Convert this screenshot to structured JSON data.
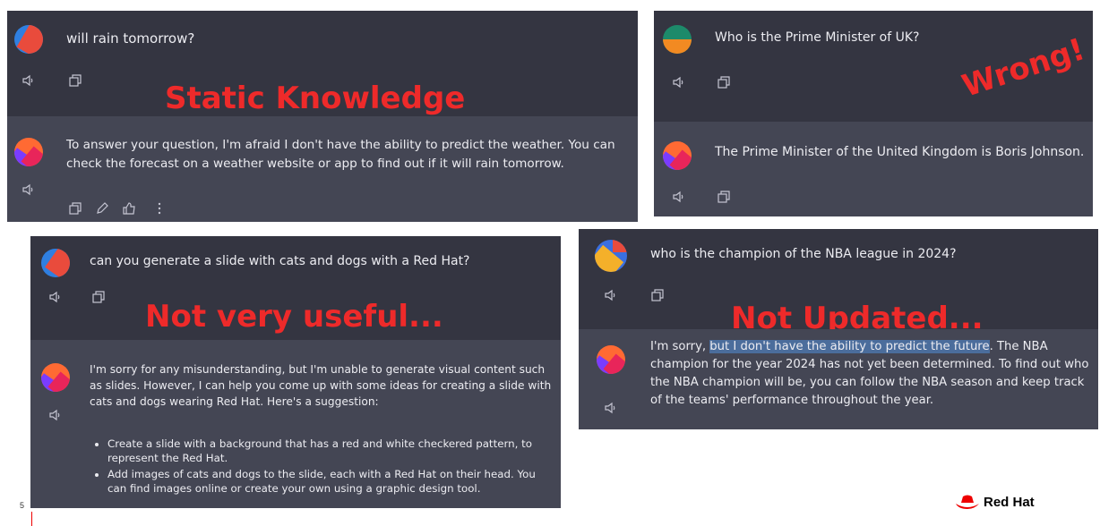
{
  "panel1": {
    "question": "will rain tomorrow?",
    "overlay": "Static Knowledge",
    "answer": "To answer your question, I'm afraid I don't have the ability to predict the weather. You can check the forecast on a weather website or app to find out if it will rain tomorrow."
  },
  "panel2": {
    "question": "Who is the Prime Minister of UK?",
    "overlay": "Wrong!",
    "answer": "The Prime Minister of the United Kingdom is Boris Johnson."
  },
  "panel3": {
    "question": "can you generate a slide with cats and dogs with a Red Hat?",
    "overlay": "Not very useful...",
    "answer": "I'm sorry for any misunderstanding, but I'm unable to generate visual content such as slides. However, I can help you come up with some ideas for creating a slide with cats and dogs wearing Red Hat. Here's a suggestion:",
    "bullets": [
      "Create a slide with a background that has a red and white checkered pattern, to represent the Red Hat.",
      "Add images of cats and dogs to the slide, each with a Red Hat on their head. You can find images online or create your own using a graphic design tool."
    ]
  },
  "panel4": {
    "question": "who is the champion of the NBA league in 2024?",
    "overlay": "Not Updated...",
    "answer_pre": "I'm sorry, ",
    "answer_hl": "but I don't have the ability to predict the future",
    "answer_post": ". The NBA champion for the year 2024 has not yet been determined. To find out who the NBA champion will be, you can follow the NBA season and keep track of the teams' performance throughout the year."
  },
  "slide_number": "5",
  "logo": "Red Hat",
  "colors": {
    "question_bg": "#343541",
    "answer_bg": "#444654",
    "overlay_red": "#ee2a2a",
    "highlight": "#4b6d9c"
  }
}
